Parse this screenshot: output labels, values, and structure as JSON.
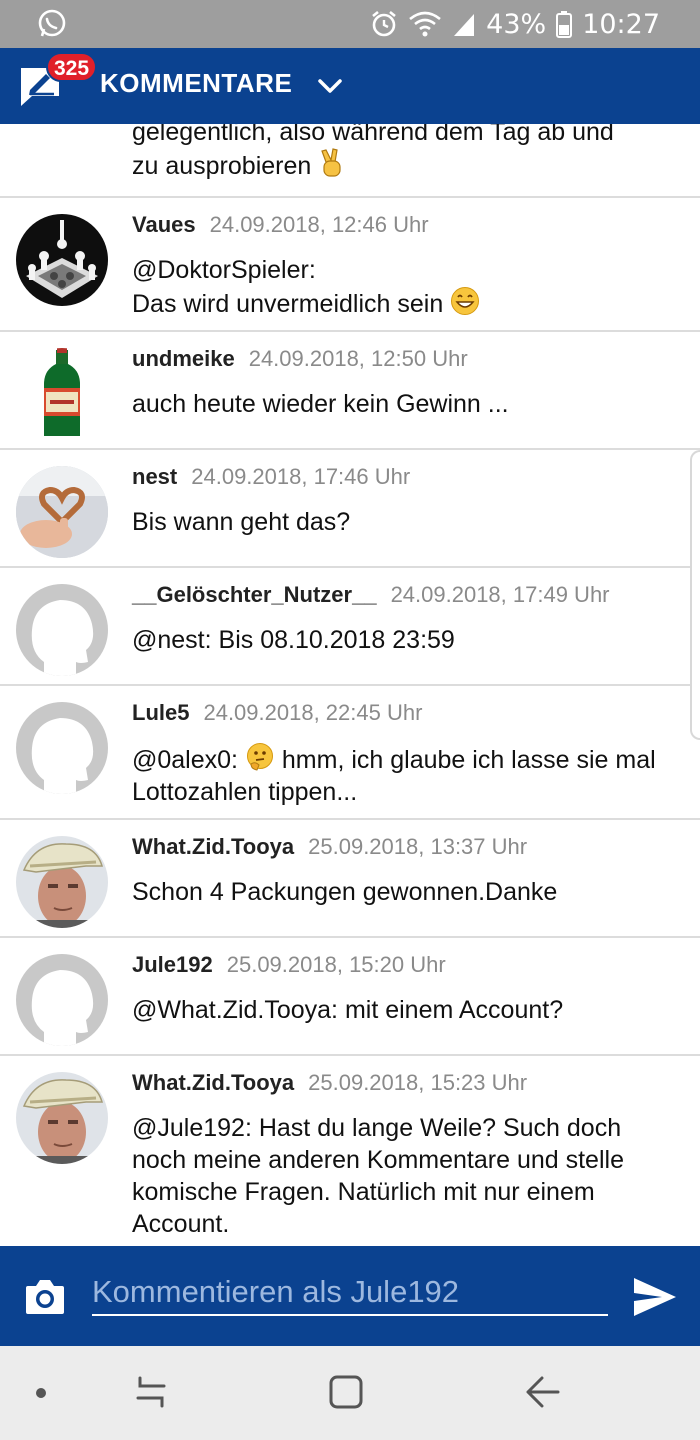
{
  "status_bar": {
    "battery": "43%",
    "time": "10:27"
  },
  "header": {
    "badge_count": "325",
    "title": "KOMMENTARE"
  },
  "partial_comment": {
    "line1": "gelegentlich, also während dem Tag ab und",
    "line2": "zu ausprobieren"
  },
  "comments": [
    {
      "user": "Vaues",
      "date": "24.09.2018, 12:46 Uhr",
      "text": "@DoktorSpieler:",
      "text2": "Das wird unvermeidlich sein",
      "avatar": "chess-avatar"
    },
    {
      "user": "undmeike",
      "date": "24.09.2018, 12:50 Uhr",
      "text": "auch heute wieder kein Gewinn ...",
      "avatar": "bottle-avatar"
    },
    {
      "user": "nest",
      "date": "24.09.2018, 17:46 Uhr",
      "text": "Bis wann geht das?",
      "avatar": "heart-pretzel-avatar"
    },
    {
      "user": "__Gelöschter_Nutzer__",
      "date": "24.09.2018, 17:49 Uhr",
      "text": "@nest: Bis 08.10.2018 23:59",
      "avatar": "default-avatar"
    },
    {
      "user": "Lule5",
      "date": "24.09.2018, 22:45 Uhr",
      "text_prefix": "@0alex0:",
      "text": "hmm, ich glaube ich lasse sie mal Lottozahlen tippen...",
      "avatar": "default-avatar"
    },
    {
      "user": "What.Zid.Tooya",
      "date": "25.09.2018, 13:37 Uhr",
      "text": "Schon 4 Packungen gewonnen.Danke",
      "avatar": "man-hat-avatar"
    },
    {
      "user": "Jule192",
      "date": "25.09.2018, 15:20 Uhr",
      "text": "@What.Zid.Tooya: mit einem Account?",
      "avatar": "default-avatar"
    },
    {
      "user": "What.Zid.Tooya",
      "date": "25.09.2018, 15:23 Uhr",
      "text": "@Jule192: Hast du lange Weile? Such doch noch meine anderen Kommentare und stelle komische Fragen. Natürlich mit nur einem Account.",
      "avatar": "man-hat-avatar"
    }
  ],
  "input": {
    "placeholder": "Kommentieren als Jule192"
  },
  "colors": {
    "header_bg": "#0b4290",
    "badge_bg": "#e0202a",
    "statusbar_bg": "#9e9e9e",
    "navbar_bg": "#ececec"
  },
  "icons": [
    "whatsapp-icon",
    "alarm-icon",
    "wifi-icon",
    "signal-icon",
    "battery-icon",
    "comment-logo-icon",
    "chevron-down-icon",
    "camera-icon",
    "send-icon",
    "nav-dot-icon",
    "recent-apps-icon",
    "home-icon",
    "back-icon"
  ]
}
